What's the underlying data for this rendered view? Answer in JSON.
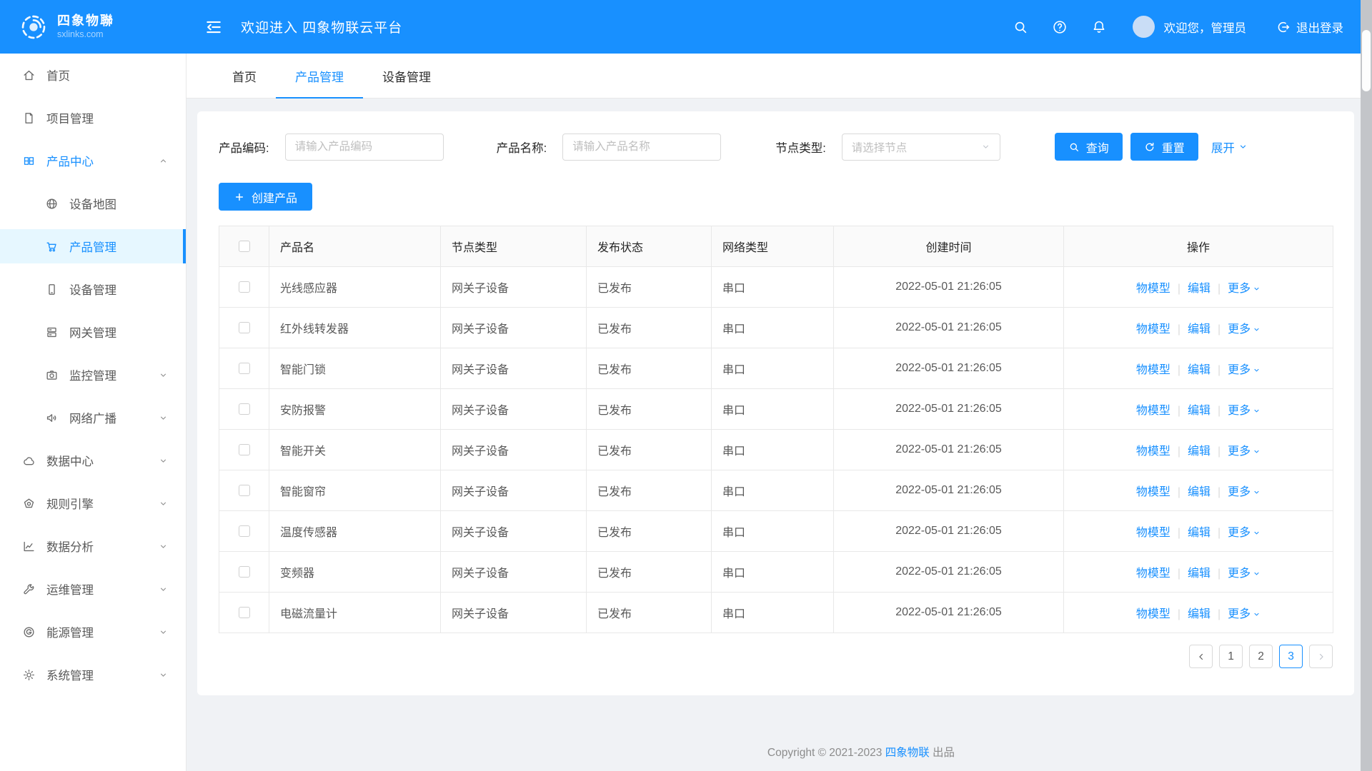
{
  "brand": {
    "name": "四象物聯",
    "domain": "sxlinks.com"
  },
  "header": {
    "title": "欢迎进入 四象物联云平台",
    "user_greeting": "欢迎您，管理员",
    "logout_label": "退出登录",
    "icons": [
      "search",
      "help",
      "bell"
    ]
  },
  "colors": {
    "primary": "#1890ff",
    "active_menu_bg": "#e6f7ff",
    "content_bg": "#f0f2f5",
    "header_bg": "#1890ff"
  },
  "sidebar": {
    "items": [
      {
        "key": "home",
        "label": "首页",
        "icon": "home",
        "level": 1
      },
      {
        "key": "project-management",
        "label": "项目管理",
        "icon": "project",
        "level": 1
      },
      {
        "key": "product-center",
        "label": "产品中心",
        "icon": "grid",
        "level": 1,
        "highlight": true,
        "expand": "up"
      },
      {
        "key": "device-map",
        "label": "设备地图",
        "icon": "globe",
        "level": 2
      },
      {
        "key": "product-management",
        "label": "产品管理",
        "icon": "cart",
        "level": 2,
        "active": true
      },
      {
        "key": "device-management",
        "label": "设备管理",
        "icon": "phone",
        "level": 2
      },
      {
        "key": "gateway-management",
        "label": "网关管理",
        "icon": "server",
        "level": 2
      },
      {
        "key": "monitor-management",
        "label": "监控管理",
        "icon": "camera",
        "level": 2,
        "expand": "down"
      },
      {
        "key": "network-broadcast",
        "label": "网络广播",
        "icon": "speaker",
        "level": 2,
        "expand": "down"
      },
      {
        "key": "data-center",
        "label": "数据中心",
        "icon": "cloud",
        "level": 1,
        "expand": "down"
      },
      {
        "key": "rule-engine",
        "label": "规则引擎",
        "icon": "pentagon",
        "level": 1,
        "expand": "down"
      },
      {
        "key": "data-analysis",
        "label": "数据分析",
        "icon": "chart",
        "level": 1,
        "expand": "down"
      },
      {
        "key": "ops-management",
        "label": "运维管理",
        "icon": "wrench",
        "level": 1,
        "expand": "down"
      },
      {
        "key": "energy-management",
        "label": "能源管理",
        "icon": "energy",
        "level": 1,
        "expand": "down"
      },
      {
        "key": "system-management",
        "label": "系统管理",
        "icon": "gear",
        "level": 1,
        "expand": "down"
      }
    ]
  },
  "tabs": [
    {
      "label": "首页",
      "active": false
    },
    {
      "label": "产品管理",
      "active": true
    },
    {
      "label": "设备管理",
      "active": false
    }
  ],
  "filters": {
    "product_code": {
      "label": "产品编码:",
      "placeholder": "请输入产品编码",
      "value": ""
    },
    "product_name": {
      "label": "产品名称:",
      "placeholder": "请输入产品名称",
      "value": ""
    },
    "node_type": {
      "label": "节点类型:",
      "placeholder": "请选择节点"
    },
    "search_label": "查询",
    "reset_label": "重置",
    "expand_label": "展开"
  },
  "toolbar": {
    "create_label": "创建产品"
  },
  "table": {
    "columns": [
      "产品名",
      "节点类型",
      "发布状态",
      "网络类型",
      "创建时间",
      "操作"
    ],
    "actions": [
      "物模型",
      "编辑",
      "更多"
    ],
    "rows": [
      {
        "name": "光线感应器",
        "node_type": "网关子设备",
        "publish_status": "已发布",
        "network_type": "串口",
        "created_at": "2022-05-01 21:26:05"
      },
      {
        "name": "红外线转发器",
        "node_type": "网关子设备",
        "publish_status": "已发布",
        "network_type": "串口",
        "created_at": "2022-05-01 21:26:05"
      },
      {
        "name": "智能门锁",
        "node_type": "网关子设备",
        "publish_status": "已发布",
        "network_type": "串口",
        "created_at": "2022-05-01 21:26:05"
      },
      {
        "name": "安防报警",
        "node_type": "网关子设备",
        "publish_status": "已发布",
        "network_type": "串口",
        "created_at": "2022-05-01 21:26:05"
      },
      {
        "name": "智能开关",
        "node_type": "网关子设备",
        "publish_status": "已发布",
        "network_type": "串口",
        "created_at": "2022-05-01 21:26:05"
      },
      {
        "name": "智能窗帘",
        "node_type": "网关子设备",
        "publish_status": "已发布",
        "network_type": "串口",
        "created_at": "2022-05-01 21:26:05"
      },
      {
        "name": "温度传感器",
        "node_type": "网关子设备",
        "publish_status": "已发布",
        "network_type": "串口",
        "created_at": "2022-05-01 21:26:05"
      },
      {
        "name": "变频器",
        "node_type": "网关子设备",
        "publish_status": "已发布",
        "network_type": "串口",
        "created_at": "2022-05-01 21:26:05"
      },
      {
        "name": "电磁流量计",
        "node_type": "网关子设备",
        "publish_status": "已发布",
        "network_type": "串口",
        "created_at": "2022-05-01 21:26:05"
      }
    ]
  },
  "pagination": {
    "pages": [
      "1",
      "2",
      "3"
    ],
    "current": "3",
    "prev_enabled": true,
    "next_enabled": false
  },
  "footer": {
    "text_prefix": "Copyright © 2021-2023 ",
    "brand": "四象物联",
    "text_suffix": " 出品"
  }
}
